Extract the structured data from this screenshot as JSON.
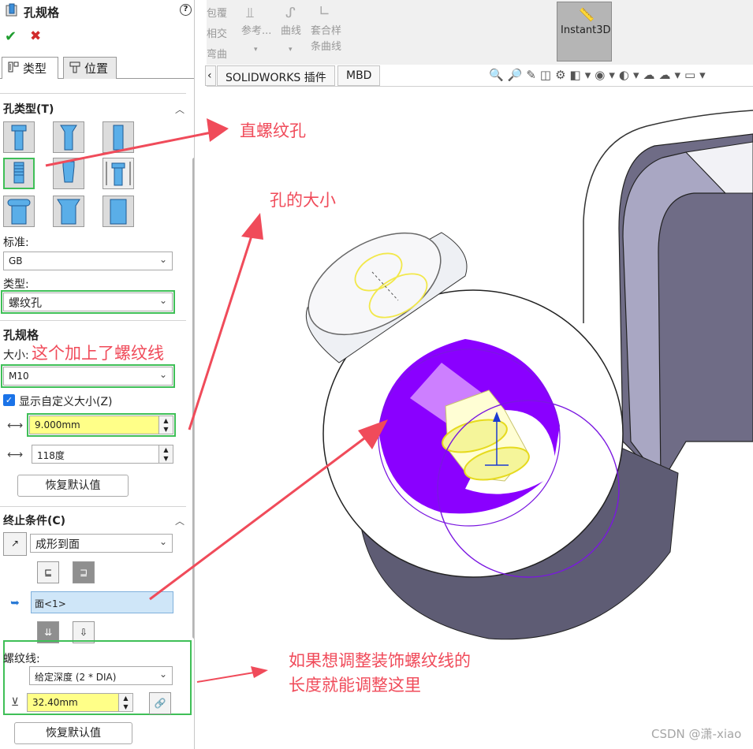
{
  "panel": {
    "title": "孔规格",
    "help_label": "?",
    "ok_label": "✔",
    "cancel_label": "✖",
    "tabs": [
      {
        "label": "类型"
      },
      {
        "label": "位置"
      }
    ],
    "hole_type_header": "孔类型(T)",
    "standard_label": "标准:",
    "standard_value": "GB",
    "type_label": "类型:",
    "type_value": "螺纹孔",
    "spec_header": "孔规格",
    "size_label": "大小:",
    "size_value": "M10",
    "custom_size_label": "显示自定义大小(Z)",
    "custom_size_checked": true,
    "diameter_value": "9.000mm",
    "angle_value": "118度",
    "restore_default_label": "恢复默认值",
    "end_condition_header": "终止条件(C)",
    "end_condition_value": "成形到面",
    "face_value": "面<1>",
    "thread_label": "螺纹线:",
    "thread_value": "给定深度 (2 * DIA)",
    "thread_depth_value": "32.40mm",
    "restore_default_label_2": "恢复默认值"
  },
  "toolbar": {
    "partial_items": [
      "包覆",
      "相交",
      "弯曲"
    ],
    "ref_label": "参考...",
    "curve_label": "曲线",
    "composite_label_1": "套合样",
    "composite_label_2": "条曲线",
    "instant3d_label": "Instant3D"
  },
  "command_tabs": [
    {
      "label": "SOLIDWORKS 插件"
    },
    {
      "label": "MBD"
    }
  ],
  "annotations": {
    "straight_thread_hole": "直螺纹孔",
    "hole_size": "孔的大小",
    "thread_added": "这个加上了螺纹线",
    "thread_length_line1": "如果想调整装饰螺纹线的",
    "thread_length_line2": "长度就能调整这里"
  },
  "watermark": "CSDN @潇-xiao",
  "colors": {
    "annotation": "#f04b5a",
    "highlight": "#3fbf57",
    "hole_purple": "#8a00ff",
    "thread_yellow": "#ffff88"
  }
}
